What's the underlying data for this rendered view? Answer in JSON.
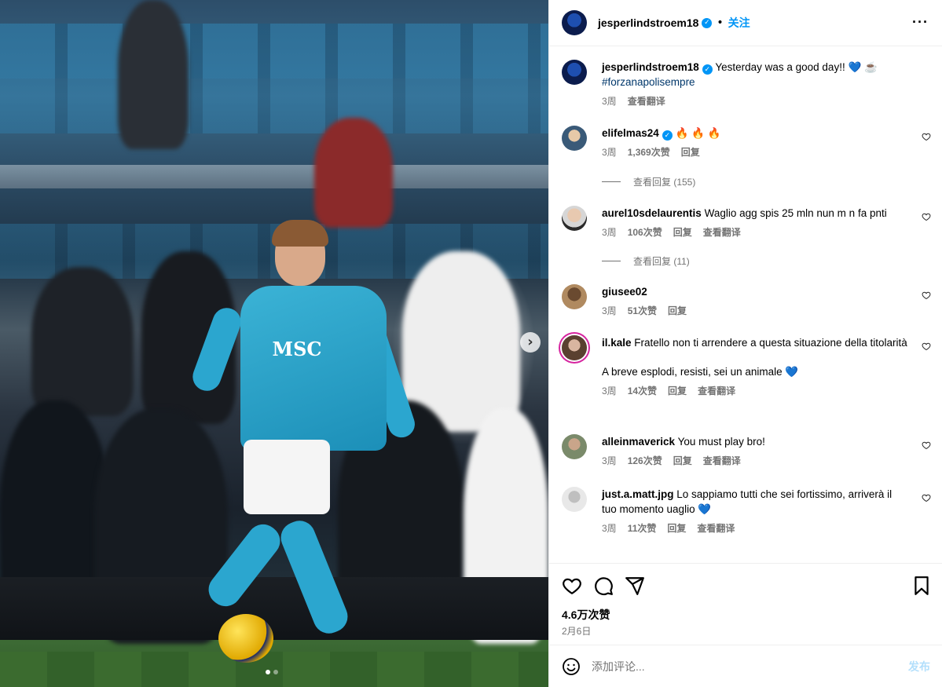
{
  "post": {
    "owner": "jesperlindstroem18",
    "follow_label": "关注",
    "more_label": "···",
    "caption_text": "Yesterday was a good day!! 💙 ☕",
    "caption_hashtag": "#forzanapolisempre",
    "caption_time": "3周",
    "caption_translate": "查看翻译",
    "likes": "4.6万次赞",
    "date": "2月6日"
  },
  "comments": [
    {
      "user": "elifelmas24",
      "verified": true,
      "text": "🔥 🔥 🔥",
      "time": "3周",
      "likes": "1,369次赞",
      "reply": "回复",
      "translate": "",
      "view_replies": "查看回复 (155)"
    },
    {
      "user": "aurel10sdelaurentis",
      "verified": false,
      "text": "Waglio agg spis 25 mln nun m n fa pnti",
      "time": "3周",
      "likes": "106次赞",
      "reply": "回复",
      "translate": "查看翻译",
      "view_replies": "查看回复 (11)"
    },
    {
      "user": "giusee02",
      "verified": false,
      "text": "",
      "time": "3周",
      "likes": "51次赞",
      "reply": "回复",
      "translate": "",
      "view_replies": ""
    },
    {
      "user": "il.kale",
      "verified": false,
      "text": "Fratello non ti arrendere a questa situazione della titolarità",
      "text2": "A breve esplodi, resisti, sei un animale 💙",
      "time": "3周",
      "likes": "14次赞",
      "reply": "回复",
      "translate": "查看翻译",
      "view_replies": ""
    },
    {
      "user": "alleinmaverick",
      "verified": false,
      "text": "You must play bro!",
      "time": "3周",
      "likes": "126次赞",
      "reply": "回复",
      "translate": "查看翻译",
      "view_replies": ""
    },
    {
      "user": "just.a.matt.jpg",
      "verified": false,
      "text": "Lo sappiamo tutti che sei fortissimo, arriverà il tuo momento uaglio 💙",
      "time": "3周",
      "likes": "11次赞",
      "reply": "回复",
      "translate": "查看翻译",
      "view_replies": ""
    }
  ],
  "composer": {
    "placeholder": "添加评论...",
    "post_label": "发布"
  },
  "icons": {
    "like": "heart-icon",
    "comment": "comment-icon",
    "share": "share-icon",
    "save": "bookmark-icon",
    "emoji": "emoji-icon",
    "next": "chevron-right-icon"
  },
  "colors": {
    "accent": "#0095f6",
    "muted": "#737373",
    "hashtag": "#00376b"
  }
}
